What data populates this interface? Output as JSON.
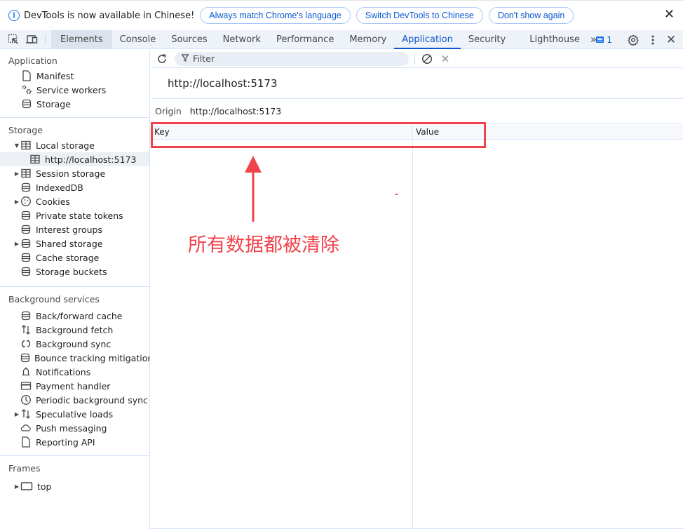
{
  "infobar": {
    "message": "DevTools is now available in Chinese!",
    "buttons": [
      "Always match Chrome's language",
      "Switch DevTools to Chinese",
      "Don't show again"
    ],
    "close_icon": "close-icon"
  },
  "toolbar": {
    "left_icons": [
      "inspect-element-icon",
      "device-toolbar-icon"
    ],
    "tabs": [
      {
        "label": "Elements",
        "active": false
      },
      {
        "label": "Console",
        "active": false
      },
      {
        "label": "Sources",
        "active": false
      },
      {
        "label": "Network",
        "active": false
      },
      {
        "label": "Performance",
        "active": false
      },
      {
        "label": "Memory",
        "active": false
      },
      {
        "label": "Application",
        "active": true
      },
      {
        "label": "Security",
        "active": false
      },
      {
        "label": "Lighthouse",
        "active": false
      }
    ],
    "more_tabs": "»",
    "messages_count": "1",
    "right_icons": [
      "settings-icon",
      "more-options-icon",
      "close-devtools-icon"
    ],
    "accent_color": "#0b57d0"
  },
  "sidebar": {
    "sections": [
      {
        "title": "Application",
        "items": [
          {
            "label": "Manifest",
            "icon": "document-icon",
            "expandable": false,
            "level": 1
          },
          {
            "label": "Service workers",
            "icon": "gears-icon",
            "expandable": false,
            "level": 1
          },
          {
            "label": "Storage",
            "icon": "database-icon",
            "expandable": false,
            "level": 1
          }
        ]
      },
      {
        "title": "Storage",
        "items": [
          {
            "label": "Local storage",
            "icon": "table-icon",
            "expandable": true,
            "expanded": true,
            "level": 1
          },
          {
            "label": "http://localhost:5173",
            "icon": "table-icon",
            "expandable": false,
            "level": 2,
            "selected": true
          },
          {
            "label": "Session storage",
            "icon": "table-icon",
            "expandable": true,
            "level": 1
          },
          {
            "label": "IndexedDB",
            "icon": "database-icon",
            "expandable": false,
            "level": 1
          },
          {
            "label": "Cookies",
            "icon": "cookie-icon",
            "expandable": true,
            "level": 1
          },
          {
            "label": "Private state tokens",
            "icon": "database-icon",
            "expandable": false,
            "level": 1
          },
          {
            "label": "Interest groups",
            "icon": "database-icon",
            "expandable": false,
            "level": 1
          },
          {
            "label": "Shared storage",
            "icon": "database-icon",
            "expandable": true,
            "level": 1
          },
          {
            "label": "Cache storage",
            "icon": "database-icon",
            "expandable": false,
            "level": 1
          },
          {
            "label": "Storage buckets",
            "icon": "database-icon",
            "expandable": false,
            "level": 1
          }
        ]
      },
      {
        "title": "Background services",
        "items": [
          {
            "label": "Back/forward cache",
            "icon": "database-icon",
            "expandable": false,
            "level": 1
          },
          {
            "label": "Background fetch",
            "icon": "up-down-arrows-icon",
            "expandable": false,
            "level": 1
          },
          {
            "label": "Background sync",
            "icon": "sync-icon",
            "expandable": false,
            "level": 1
          },
          {
            "label": "Bounce tracking mitigations",
            "icon": "database-icon",
            "expandable": false,
            "level": 1
          },
          {
            "label": "Notifications",
            "icon": "bell-icon",
            "expandable": false,
            "level": 1
          },
          {
            "label": "Payment handler",
            "icon": "credit-card-icon",
            "expandable": false,
            "level": 1
          },
          {
            "label": "Periodic background sync",
            "icon": "clock-icon",
            "expandable": false,
            "level": 1
          },
          {
            "label": "Speculative loads",
            "icon": "up-down-arrows-icon",
            "expandable": true,
            "level": 1
          },
          {
            "label": "Push messaging",
            "icon": "cloud-icon",
            "expandable": false,
            "level": 1
          },
          {
            "label": "Reporting API",
            "icon": "document-icon",
            "expandable": false,
            "level": 1
          }
        ]
      },
      {
        "title": "Frames",
        "items": [
          {
            "label": "top",
            "icon": "frame-icon",
            "expandable": true,
            "level": 1
          }
        ]
      }
    ]
  },
  "main": {
    "filter_placeholder": "Filter",
    "origin_title": "http://localhost:5173",
    "origin_label": "Origin",
    "origin_value": "http://localhost:5173",
    "columns": [
      "Key",
      "Value"
    ],
    "rows": []
  },
  "annotation": {
    "text": "所有数据都被清除",
    "color": "#f0424a"
  }
}
